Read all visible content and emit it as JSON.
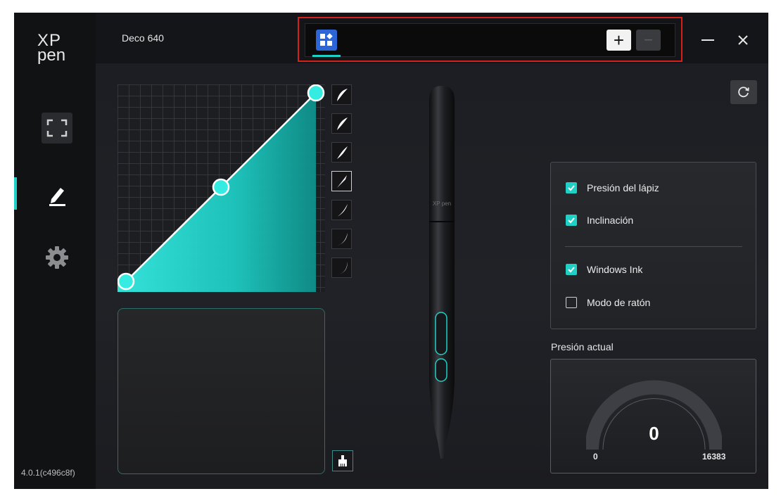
{
  "app": {
    "logo_top": "XP",
    "logo_bottom": "pen",
    "device_name": "Deco 640",
    "version": "4.0.1(c496c8f)"
  },
  "nav": [
    {
      "name": "work-area",
      "icon": "screen-frame-icon",
      "active": false
    },
    {
      "name": "pen",
      "icon": "pen-icon",
      "active": true
    },
    {
      "name": "settings",
      "icon": "gear-icon",
      "active": false
    }
  ],
  "tabs": {
    "add_label": "+",
    "remove_label": "−",
    "app_tab_icon": "apps-grid-icon"
  },
  "options": {
    "pen_pressure": {
      "label": "Presión del lápiz",
      "checked": true
    },
    "tilt": {
      "label": "Inclinación",
      "checked": true
    },
    "windows_ink": {
      "label": "Windows Ink",
      "checked": true
    },
    "mouse_mode": {
      "label": "Modo de ratón",
      "checked": false
    }
  },
  "pressure": {
    "label": "Presión actual",
    "value": "0",
    "min": "0",
    "max": "16383"
  },
  "pen_brand": "XP pen",
  "colors": {
    "accent": "#1fd0c6",
    "tab_icon": "#2b65d6",
    "highlight_frame": "#d6201c"
  }
}
